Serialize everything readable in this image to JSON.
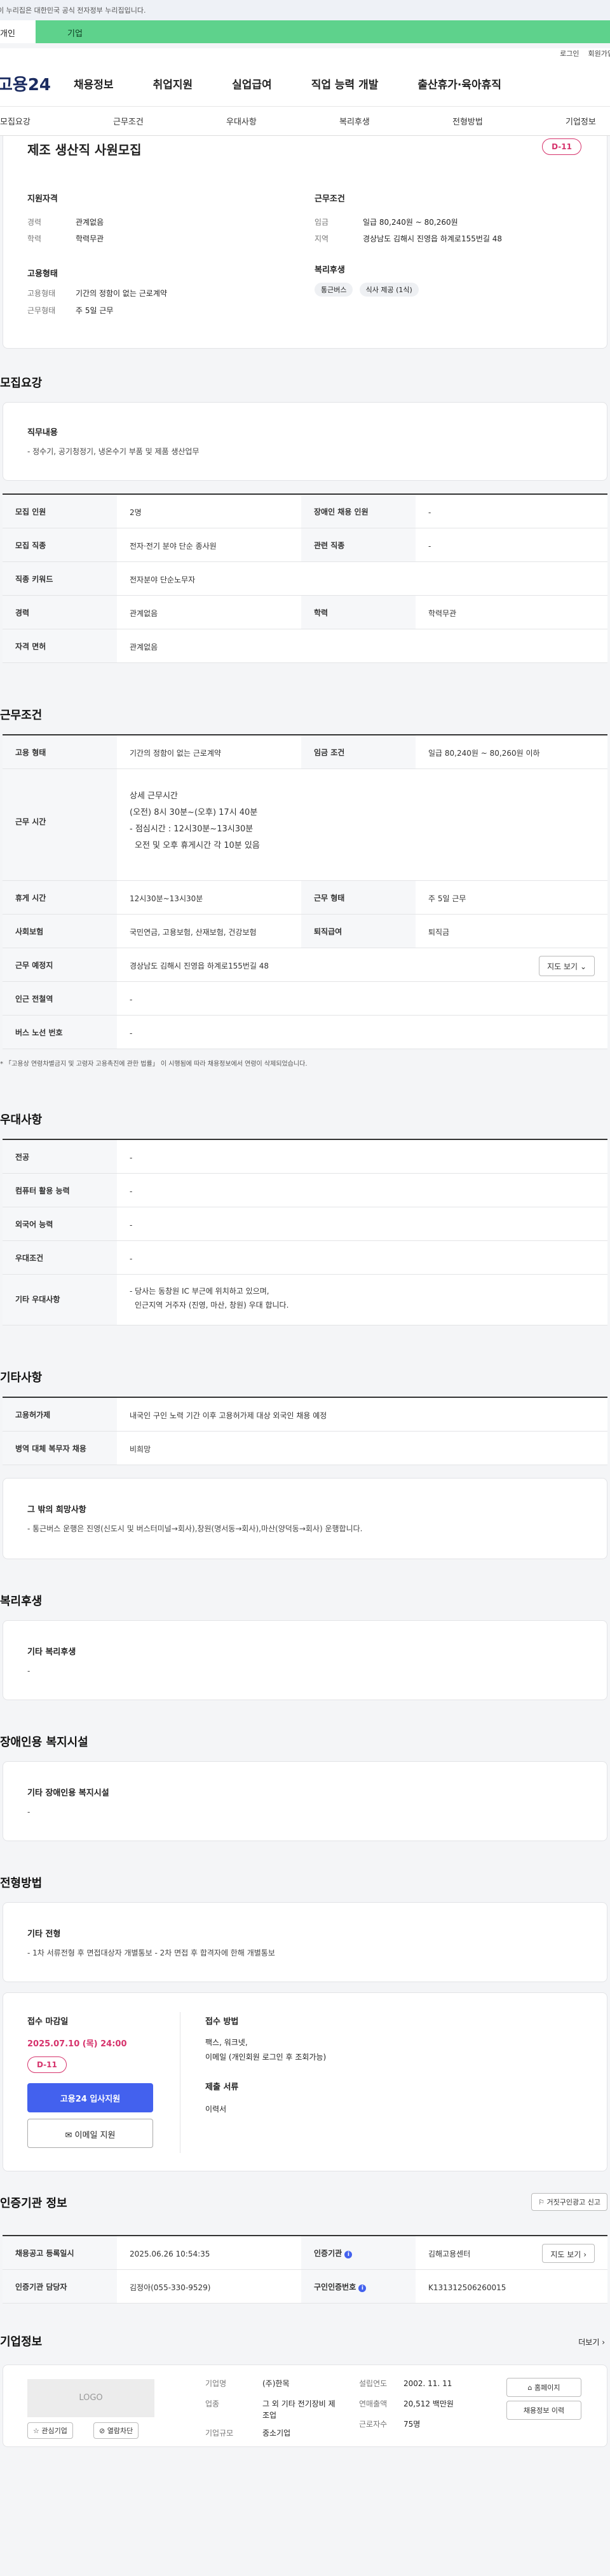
{
  "gov_banner": "이 누리집은 대한민국 공식 전자정부 누리집입니다.",
  "top_tabs": {
    "left": "개인",
    "right": "기업"
  },
  "util": {
    "login": "로그인",
    "join": "회원가입"
  },
  "logo": "고용24",
  "gnb": [
    "채용정보",
    "취업지원",
    "실업급여",
    "직업 능력 개발",
    "출산휴가·육아휴직"
  ],
  "subnav": [
    "모집요강",
    "근무조건",
    "우대사항",
    "복리후생",
    "전형방법",
    "기업정보"
  ],
  "summary": {
    "title": "제조 생산직 사원모집",
    "dday": "D-11",
    "qual_title": "지원자격",
    "career_label": "경력",
    "career": "관계없음",
    "edu_label": "학력",
    "edu": "학력무관",
    "employ_title": "고용형태",
    "employ_label": "고용형태",
    "employ": "기간의 정함이 없는 근로계약",
    "worktype_label": "근무형태",
    "worktype": "주 5일 근무",
    "cond_title": "근무조건",
    "wage_label": "임금",
    "wage": "일급 80,240원 ~ 80,260원",
    "region_label": "지역",
    "region": "경상남도 김해시 진영읍 하계로155번길 48",
    "welfare_title": "복리후생",
    "welfare_tags": [
      "통근버스",
      "식사 제공 (1식)"
    ]
  },
  "recruit": {
    "title": "모집요강",
    "job_title": "직무내용",
    "job_desc": "- 정수기, 공기청정기, 냉온수기 부품 및 제품 생산업무",
    "rows": [
      {
        "th1": "모집 인원",
        "td1": "2명",
        "th2": "장애인 채용 인원",
        "td2": "-"
      },
      {
        "th1": "모집 직종",
        "td1": "전자·전기 분야 단순 종사원",
        "th2": "관련 직종",
        "td2": "-"
      },
      {
        "th1": "직종 키워드",
        "td1": "전자분야 단순노무자"
      },
      {
        "th1": "경력",
        "td1": "관계없음",
        "th2": "학력",
        "td2": "학력무관"
      },
      {
        "th1": "자격 면허",
        "td1": "관계없음"
      }
    ]
  },
  "work": {
    "title": "근무조건",
    "employ_th": "고용 형태",
    "employ_td": "기간의 정함이 없는 근로계약",
    "wage_th": "임금 조건",
    "wage_td": "일급 80,240원 ~ 80,260원 이하",
    "time_th": "근무 시간",
    "time_lines": [
      "상세 근무시간",
      "(오전) 8시 30분~(오후) 17시 40분",
      "- 점심시간 : 12시30분~13시30분",
      "  오전 및 오후 휴게시간 각 10분 있음"
    ],
    "rest_th": "휴게 시간",
    "rest_td": "12시30분~13시30분",
    "form_th": "근무 형태",
    "form_td": "주 5일 근무",
    "ins_th": "사회보험",
    "ins_td": "국민연금, 고용보험, 산재보험, 건강보험",
    "retire_th": "퇴직급여",
    "retire_td": "퇴직금",
    "loc_th": "근무 예정지",
    "loc_td": "경상남도 김해시 진영읍 하계로155번길 48",
    "map_btn": "지도 보기",
    "subway_th": "인근 전철역",
    "subway_td": "-",
    "bus_th": "버스 노선 번호",
    "bus_td": "-",
    "note": "* 「고용상 연령차별금지 및 고령자 고용촉진에 관한 법률」 이 시행됨에 따라 채용정보에서 연령이 삭제되었습니다."
  },
  "pref": {
    "title": "우대사항",
    "rows": [
      {
        "th": "전공",
        "td": "-"
      },
      {
        "th": "컴퓨터 활용 능력",
        "td": "-"
      },
      {
        "th": "외국어 능력",
        "td": "-"
      },
      {
        "th": "우대조건",
        "td": "-"
      }
    ],
    "etc_th": "기타 우대사항",
    "etc_lines": [
      "- 당사는 동창원 IC 부근에 위치하고 있으며,",
      "  인근지역 거주자 (진영, 마산, 창원) 우대 합니다."
    ]
  },
  "other": {
    "title": "기타사항",
    "hire_th": "고용허가제",
    "hire_td": "내국인 구인 노력 기간 이후 고용허가제 대상 외국인 채용 예정",
    "mil_th": "병역 대체 복무자 채용",
    "mil_td": "비희망",
    "wish_title": "그 밖의 희망사항",
    "wish_desc": "- 통근버스 운행은 진영(신도시 및 버스터미널→회사),창원(명서동→회사),마산(양덕동→회사) 운행합니다."
  },
  "welfare": {
    "title": "복리후생",
    "box_title": "기타 복리후생",
    "box_desc": "-"
  },
  "disabled": {
    "title": "장애인용 복지시설",
    "box_title": "기타 장애인용 복지시설",
    "box_desc": "-"
  },
  "select": {
    "title": "전형방법",
    "box_title": "기타 전형",
    "box_desc": "- 1차 서류전형 후 면접대상자 개별통보 - 2차 면접 후 합격자에 한해 개별통보",
    "deadline_title": "접수 마감일",
    "deadline": "2025.07.10 (목) 24:00",
    "dday": "D-11",
    "apply_btn": "고용24 입사지원",
    "email_btn": "이메일 지원",
    "method_title": "접수 방법",
    "method_lines": [
      "팩스, 워크넷,",
      "이메일 (개인회원 로그인 후 조회가능)"
    ],
    "docs_title": "제출 서류",
    "docs": "이력서"
  },
  "cert": {
    "title": "인증기관 정보",
    "report_btn": "거짓구인광고 신고",
    "reg_th": "채용공고 등록일시",
    "reg_td": "2025.06.26 10:54:35",
    "org_th": "인증기관",
    "org_td": "김해고용센터",
    "map_btn": "지도 보기",
    "mgr_th": "인증기관 담당자",
    "mgr_td": "김정아(055-330-9529)",
    "num_th": "구인인증번호",
    "num_td": "K131312506260015"
  },
  "company": {
    "title": "기업정보",
    "more": "더보기",
    "logo_text": "LOGO",
    "interest_btn": "관심기업",
    "block_btn": "열람차단",
    "name_label": "기업명",
    "name": "(주)한목",
    "biz_label": "업종",
    "biz": "그 외 기타 전기장비 제조업",
    "scale_label": "기업규모",
    "scale": "중소기업",
    "est_label": "설립연도",
    "est": "2002. 11. 11",
    "sales_label": "연매출액",
    "sales": "20,512 백만원",
    "emp_label": "근로자수",
    "emp": "75명",
    "home_btn": "홈페이지",
    "jobs_btn": "채용정보 이력"
  }
}
